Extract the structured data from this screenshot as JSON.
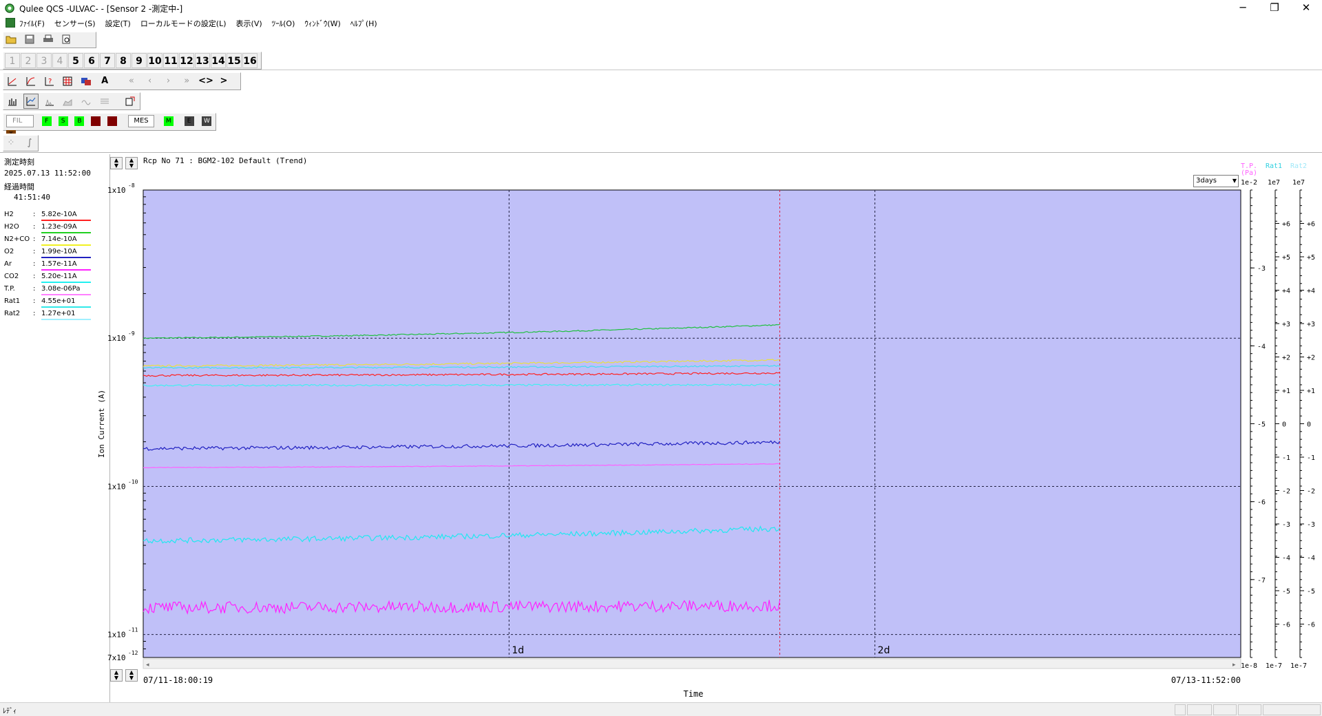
{
  "window": {
    "title": "Qulee QCS -ULVAC-  - [Sensor 2 -測定中-]",
    "minimize": "─",
    "maximize": "❐",
    "close": "✕"
  },
  "menu": {
    "items": [
      "ﾌｧｲﾙ(F)",
      "センサー(S)",
      "設定(T)",
      "ローカルモードの設定(L)",
      "表示(V)",
      "ﾂｰﾙ(O)",
      "ｳｨﾝﾄﾞｳ(W)",
      "ﾍﾙﾌﾟ(H)"
    ]
  },
  "toolbar": {
    "file_icons": [
      "open-folder-icon",
      "save-icon",
      "print-icon",
      "print-preview-icon",
      "globe-icon"
    ],
    "channels": [
      {
        "label": "1",
        "enabled": false
      },
      {
        "label": "2",
        "enabled": false
      },
      {
        "label": "3",
        "enabled": false
      },
      {
        "label": "4",
        "enabled": false
      },
      {
        "label": "5",
        "enabled": true
      },
      {
        "label": "6",
        "enabled": true
      },
      {
        "label": "7",
        "enabled": true
      },
      {
        "label": "8",
        "enabled": true
      },
      {
        "label": "9",
        "enabled": true
      },
      {
        "label": "10",
        "enabled": true
      },
      {
        "label": "11",
        "enabled": true
      },
      {
        "label": "12",
        "enabled": true
      },
      {
        "label": "13",
        "enabled": true
      },
      {
        "label": "14",
        "enabled": true
      },
      {
        "label": "15",
        "enabled": true
      },
      {
        "label": "16",
        "enabled": true
      }
    ],
    "text_a": "A",
    "fil_label": "FIL",
    "mes_label": "MES",
    "indicators": [
      {
        "label": "F",
        "color": "#00ff00"
      },
      {
        "label": "S",
        "color": "#00ff00"
      },
      {
        "label": "B",
        "color": "#00ff00"
      },
      {
        "label": "D",
        "color": "#800000"
      },
      {
        "label": "R",
        "color": "#800000"
      },
      {
        "label": "M",
        "color": "#00ff00"
      },
      {
        "label": "E",
        "color": "#404040"
      },
      {
        "label": "W",
        "color": "#404040"
      },
      {
        "label": "T",
        "color": "#804000"
      }
    ]
  },
  "left_panel": {
    "measure_time_label": "測定時刻",
    "measure_time": "2025.07.13 11:52:00",
    "elapsed_label": "経過時間",
    "elapsed": "41:51:40",
    "legend": [
      {
        "name": "H2",
        "value": "5.82e-10A",
        "color": "#ff2020"
      },
      {
        "name": "H2O",
        "value": "1.23e-09A",
        "color": "#20d020"
      },
      {
        "name": "N2+CO",
        "value": "7.14e-10A",
        "color": "#f0f020"
      },
      {
        "name": "O2",
        "value": "1.99e-10A",
        "color": "#2020c0"
      },
      {
        "name": "Ar",
        "value": "1.57e-11A",
        "color": "#ff20ff"
      },
      {
        "name": "CO2",
        "value": "5.20e-11A",
        "color": "#20f0f0"
      },
      {
        "name": "T.P.",
        "value": "3.08e-06Pa",
        "color": "#ff80ff"
      },
      {
        "name": "Rat1",
        "value": "4.55e+01",
        "color": "#30e8e8"
      },
      {
        "name": "Rat2",
        "value": "1.27e+01",
        "color": "#a0f0ff"
      }
    ]
  },
  "chart_header": {
    "recipe": "Rcp No 71 : BGM2-102 Default (Trend)",
    "range_option": "3days",
    "axis_titles": {
      "tp": "T.P.",
      "tp_unit": "(Pa)",
      "rat1": "Rat1",
      "rat2": "Rat2"
    }
  },
  "chart_data": {
    "type": "line",
    "ylabel": "Ion Current (A)",
    "xlabel": "Time",
    "yscale": "log",
    "ylim": [
      7e-12,
      1e-08
    ],
    "x_start_label": "07/11-18:00:19",
    "x_end_label": "07/13-11:52:00",
    "xlim_days": [
      0,
      3
    ],
    "measurement_end_day": 1.74,
    "x_tick_labels": [
      {
        "label": "1d",
        "day": 1
      },
      {
        "label": "2d",
        "day": 2
      }
    ],
    "y_tick_labels": [
      {
        "base": "1x10",
        "exp": "-8",
        "value": 1e-08
      },
      {
        "base": "1x10",
        "exp": "-9",
        "value": 1e-09
      },
      {
        "base": "1x10",
        "exp": "-10",
        "value": 1e-10
      },
      {
        "base": "1x10",
        "exp": "-11",
        "value": 1e-11
      },
      {
        "base": "7x10",
        "exp": "-12",
        "value": 7e-12
      }
    ],
    "background": "#c0c0f8",
    "series": [
      {
        "name": "H2O",
        "color": "#20c040",
        "start": 1e-09,
        "end": 1.23e-09,
        "noise": 0.004
      },
      {
        "name": "N2+CO",
        "color": "#e8e040",
        "start": 6.5e-10,
        "end": 7.14e-10,
        "noise": 0.006
      },
      {
        "name": "Rat1",
        "color": "#40e0f0",
        "start": 6.3e-10,
        "end": 6.5e-10,
        "noise": 0.005
      },
      {
        "name": "H2",
        "color": "#ff2020",
        "start": 5.6e-10,
        "end": 5.82e-10,
        "noise": 0.006
      },
      {
        "name": "Rat2",
        "color": "#40f0f0",
        "start": 4.8e-10,
        "end": 4.85e-10,
        "noise": 0.006
      },
      {
        "name": "O2",
        "color": "#2020c0",
        "start": 1.8e-10,
        "end": 1.99e-10,
        "noise": 0.012
      },
      {
        "name": "T.P.",
        "color": "#ff60ff",
        "start": 1.34e-10,
        "end": 1.42e-10,
        "noise": 0.002
      },
      {
        "name": "CO2",
        "color": "#20e8f0",
        "start": 4.3e-11,
        "end": 5.2e-11,
        "noise": 0.018
      },
      {
        "name": "Ar",
        "color": "#ff20ff",
        "start": 1.52e-11,
        "end": 1.57e-11,
        "noise": 0.04
      }
    ],
    "right_axes": {
      "tp": {
        "top": "1e-2",
        "bottom": "1e-8",
        "ticks": [
          "-3",
          "-4",
          "-5",
          "-6",
          "-7"
        ]
      },
      "rat1": {
        "top": "1e7",
        "bottom": "1e-7",
        "ticks": [
          "+6",
          "+5",
          "+4",
          "+3",
          "+2",
          "+1",
          "0",
          "-1",
          "-2",
          "-3",
          "-4",
          "-5",
          "-6"
        ]
      },
      "rat2": {
        "top": "1e7",
        "bottom": "1e-7",
        "ticks": [
          "+6",
          "+5",
          "+4",
          "+3",
          "+2",
          "+1",
          "0",
          "-1",
          "-2",
          "-3",
          "-4",
          "-5",
          "-6"
        ]
      }
    }
  },
  "status": {
    "left": "ﾚﾃﾞｨ"
  }
}
